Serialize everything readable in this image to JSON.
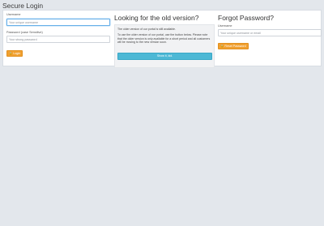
{
  "page": {
    "title": "Secure Login"
  },
  "login": {
    "username_label": "Username",
    "username_placeholder": "Your unique username",
    "password_label": "Password (case Sensitive)",
    "password_placeholder": "Your strong password",
    "login_button": "Login",
    "login_icon": "lock-icon"
  },
  "old_version": {
    "heading": "Looking for the old version?",
    "line1": "The older version of our portal is still available.",
    "line2": "To use the older version of our portal, use the button below. Please note that the older version is only available for a short period and all customers will be moving to the new version soon.",
    "button": "Show it, kid."
  },
  "forgot": {
    "heading": "Forgot Password?",
    "username_label": "Username",
    "username_placeholder": "Your unique username or email",
    "reset_button": "Reset Password",
    "reset_icon": "lock-icon"
  },
  "colors": {
    "background": "#e3e7ec",
    "primary_button": "#f0a030",
    "info_button": "#4db8d5",
    "focus": "#66afe9"
  }
}
